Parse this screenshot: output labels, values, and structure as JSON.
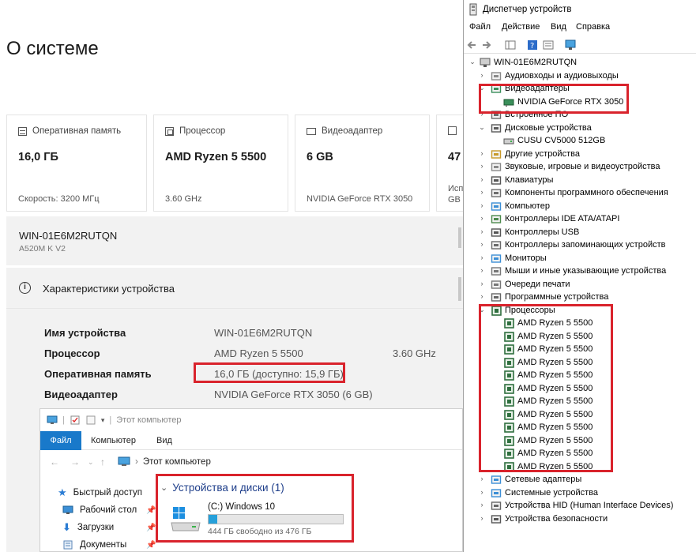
{
  "settings": {
    "page_title": "О системе",
    "cards": [
      {
        "caption": "Оперативная память",
        "value": "16,0 ГБ",
        "sub": "Скорость: 3200 МГц",
        "icon": "ram-icon"
      },
      {
        "caption": "Процессор",
        "value": "AMD Ryzen 5 5500",
        "sub": "3.60 GHz",
        "icon": "cpu-icon"
      },
      {
        "caption": "Видеоадаптер",
        "value": "6 GB",
        "sub": "NVIDIA GeForce RTX 3050",
        "icon": "gpu-icon"
      },
      {
        "caption": "",
        "value": "47",
        "sub": "Исп GB",
        "icon": "storage-icon"
      }
    ],
    "device_name": "WIN-01E6M2RUTQN",
    "device_model": "A520M K V2",
    "spec_title": "Характеристики устройства",
    "specs": [
      {
        "key": "Имя устройства",
        "value": "WIN-01E6M2RUTQN",
        "extra": ""
      },
      {
        "key": "Процессор",
        "value": "AMD Ryzen 5 5500",
        "extra": "3.60 GHz"
      },
      {
        "key": "Оперативная память",
        "value": "16,0 ГБ (доступно: 15,9 ГБ)",
        "extra": ""
      },
      {
        "key": "Видеоадаптер",
        "value": "NVIDIA GeForce RTX 3050 (6 GB)",
        "extra": ""
      }
    ]
  },
  "explorer": {
    "title": "Этот компьютер",
    "ribbon_tabs": [
      "Файл",
      "Компьютер",
      "Вид"
    ],
    "address": "Этот компьютер",
    "sidebar": [
      {
        "label": "Быстрый доступ",
        "icon": "star-icon",
        "pinned": false
      },
      {
        "label": "Рабочий стол",
        "icon": "desktop-icon",
        "pinned": true
      },
      {
        "label": "Загрузки",
        "icon": "download-icon",
        "pinned": true
      },
      {
        "label": "Документы",
        "icon": "documents-icon",
        "pinned": true
      }
    ],
    "group_label": "Устройства и диски (1)",
    "drive": {
      "name": "(C:) Windows 10",
      "free": "444 ГБ свободно из 476 ГБ",
      "used_fraction": 0.067
    }
  },
  "devmgr": {
    "title": "Диспетчер устройств",
    "menu": [
      "Файл",
      "Действие",
      "Вид",
      "Справка"
    ],
    "root": "WIN-01E6M2RUTQN",
    "tree": [
      {
        "label": "Аудиовходы и аудиовыходы",
        "level": 1,
        "expanded": false
      },
      {
        "label": "Видеоадаптеры",
        "level": 1,
        "expanded": true
      },
      {
        "label": "NVIDIA GeForce RTX 3050",
        "level": 2
      },
      {
        "label": "Встроенное ПО",
        "level": 1,
        "expanded": false
      },
      {
        "label": "Дисковые устройства",
        "level": 1,
        "expanded": true
      },
      {
        "label": "CUSU CV5000 512GB",
        "level": 2
      },
      {
        "label": "Другие устройства",
        "level": 1,
        "expanded": false
      },
      {
        "label": "Звуковые, игровые и видеоустройства",
        "level": 1,
        "expanded": false
      },
      {
        "label": "Клавиатуры",
        "level": 1,
        "expanded": false
      },
      {
        "label": "Компоненты программного обеспечения",
        "level": 1,
        "expanded": false
      },
      {
        "label": "Компьютер",
        "level": 1,
        "expanded": false
      },
      {
        "label": "Контроллеры IDE ATA/ATAPI",
        "level": 1,
        "expanded": false
      },
      {
        "label": "Контроллеры USB",
        "level": 1,
        "expanded": false
      },
      {
        "label": "Контроллеры запоминающих устройств",
        "level": 1,
        "expanded": false
      },
      {
        "label": "Мониторы",
        "level": 1,
        "expanded": false
      },
      {
        "label": "Мыши и иные указывающие устройства",
        "level": 1,
        "expanded": false
      },
      {
        "label": "Очереди печати",
        "level": 1,
        "expanded": false
      },
      {
        "label": "Программные устройства",
        "level": 1,
        "expanded": false
      },
      {
        "label": "Процессоры",
        "level": 1,
        "expanded": true
      },
      {
        "label": "AMD Ryzen 5 5500",
        "level": 2
      },
      {
        "label": "AMD Ryzen 5 5500",
        "level": 2
      },
      {
        "label": "AMD Ryzen 5 5500",
        "level": 2
      },
      {
        "label": "AMD Ryzen 5 5500",
        "level": 2
      },
      {
        "label": "AMD Ryzen 5 5500",
        "level": 2
      },
      {
        "label": "AMD Ryzen 5 5500",
        "level": 2
      },
      {
        "label": "AMD Ryzen 5 5500",
        "level": 2
      },
      {
        "label": "AMD Ryzen 5 5500",
        "level": 2
      },
      {
        "label": "AMD Ryzen 5 5500",
        "level": 2
      },
      {
        "label": "AMD Ryzen 5 5500",
        "level": 2
      },
      {
        "label": "AMD Ryzen 5 5500",
        "level": 2
      },
      {
        "label": "AMD Ryzen 5 5500",
        "level": 2
      },
      {
        "label": "Сетевые адаптеры",
        "level": 1,
        "expanded": false
      },
      {
        "label": "Системные устройства",
        "level": 1,
        "expanded": false
      },
      {
        "label": "Устройства HID (Human Interface Devices)",
        "level": 1,
        "expanded": false
      },
      {
        "label": "Устройства безопасности",
        "level": 1,
        "expanded": false
      }
    ]
  },
  "colors": {
    "accent": "#1979ca",
    "callout": "#d9232c",
    "drive_fill": "#26a0da",
    "link": "#1e3e8a"
  }
}
